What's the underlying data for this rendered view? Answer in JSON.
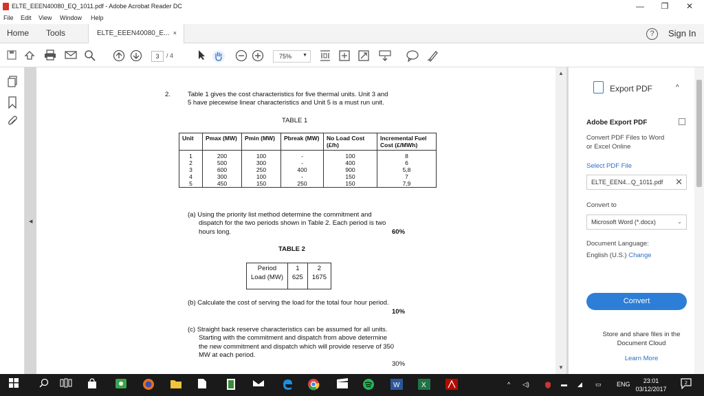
{
  "window": {
    "title": "ELTE_EEEN40080_EQ_1011.pdf - Adobe Acrobat Reader DC",
    "minimize": "—",
    "restore": "❐",
    "close": "✕"
  },
  "menu": [
    "File",
    "Edit",
    "View",
    "Window",
    "Help"
  ],
  "tabs": {
    "home": "Home",
    "tools": "Tools",
    "document": "ELTE_EEEN40080_E...",
    "document_close": "×",
    "help": "?",
    "sign_in": "Sign In"
  },
  "toolbar": {
    "page_current": "3",
    "page_total": "/ 4",
    "zoom": "75%",
    "icons": [
      "save-icon",
      "upload-icon",
      "print-icon",
      "email-icon",
      "search-icon",
      "page-up-icon",
      "page-down-icon",
      "select-arrow-icon",
      "hand-icon",
      "zoom-out-icon",
      "zoom-in-icon",
      "fit-page-icon",
      "page-layout-icon",
      "fullscreen-icon",
      "keyboard-icon",
      "comment-icon",
      "sign-pen-icon"
    ]
  },
  "document": {
    "q_number": "2.",
    "intro_line1": "Table 1 gives the cost characteristics for five thermal units.  Unit 3 and",
    "intro_line2": "5 have piecewise linear characteristics and Unit 5 is a must run unit.",
    "table1_title": "TABLE 1",
    "table1_headers": [
      "Unit",
      "Pmax (MW)",
      "Pmin (MW)",
      "Pbreak (MW)",
      "No Load Cost (£/h)",
      "Incremental Fuel Cost (£/MWh)"
    ],
    "table1_rows": [
      [
        "1",
        "200",
        "100",
        "-",
        "100",
        "8"
      ],
      [
        "2",
        "500",
        "300",
        "-",
        "400",
        "6"
      ],
      [
        "3",
        "600",
        "250",
        "400",
        "900",
        "5,8"
      ],
      [
        "4",
        "300",
        "100",
        "-",
        "150",
        "7"
      ],
      [
        "5",
        "450",
        "150",
        "250",
        "150",
        "7,9"
      ]
    ],
    "part_a_line1": "(a) Using the priority list method determine the commitment and",
    "part_a_line2": "dispatch for the two periods shown in Table 2. Each period is two",
    "part_a_line3": "hours long.",
    "part_a_marks": "60%",
    "table2_title": "TABLE 2",
    "table2_col_labels": [
      "Period",
      "Load (MW)"
    ],
    "table2_periods": [
      "1",
      "2"
    ],
    "table2_loads": [
      "625",
      "1675"
    ],
    "part_b_line1": "(b) Calculate the cost of serving the load for the total four hour period.",
    "part_b_marks": "10%",
    "part_c_line1": "(c) Straight back reserve characteristics can be assumed for all units.",
    "part_c_line2": "Starting with the commitment and dispatch from above determine",
    "part_c_line3": "the new commitment and dispatch which will provide reserve of 350",
    "part_c_line4": "MW at each period.",
    "part_c_marks": "30%"
  },
  "right_pane": {
    "export_title": "Export PDF",
    "section_title": "Adobe Export PDF",
    "desc1": "Convert PDF Files to Word",
    "desc2": "or Excel Online",
    "select_label": "Select PDF File",
    "file_name": "ELTE_EEN4...Q_1011.pdf",
    "convert_to_label": "Convert to",
    "convert_to_value": "Microsoft Word (*.docx)",
    "lang_label": "Document Language:",
    "lang_value": "English (U.S.)",
    "lang_change": "Change",
    "convert_button": "Convert",
    "store1": "Store and share files in the",
    "store2": "Document Cloud",
    "learn_more": "Learn More"
  },
  "taskbar": {
    "language": "ENG",
    "time": "23:01",
    "date": "03/12/2017",
    "notifications": "2"
  },
  "colors": {
    "accent": "#2d7ed6",
    "acrobat_red": "#d4342a",
    "taskbar": "#1a1a1a"
  }
}
